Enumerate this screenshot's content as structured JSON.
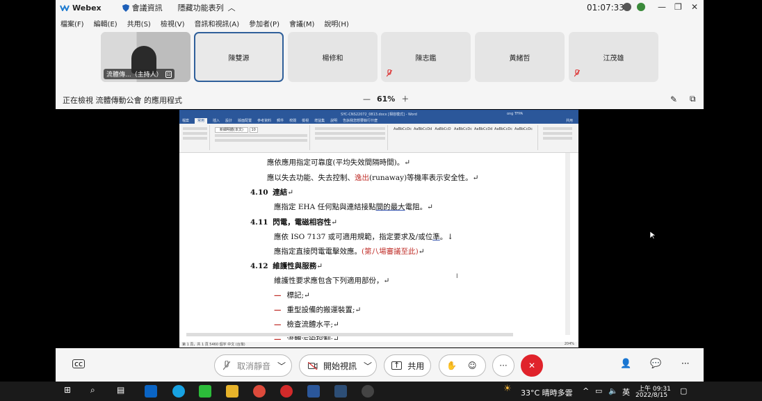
{
  "titlebar": {
    "app": "Webex",
    "meeting_info": "會議資訊",
    "hidden_list": "隱藏功能表列",
    "time": "01:07:33"
  },
  "menu": [
    "檔案(F)",
    "編輯(E)",
    "共用(S)",
    "檢視(V)",
    "音訊和視訊(A)",
    "參加者(P)",
    "會議(M)",
    "說明(H)"
  ],
  "participants": {
    "host": "流體傳...（主持人）",
    "names": [
      "陳雙源",
      "楊修和",
      "陳志鑑",
      "黃緒哲",
      "江茂雄"
    ]
  },
  "viewbar": {
    "viewing": "正在檢視 流體傳動公會 的應用程式",
    "zoom": "61%"
  },
  "word": {
    "title": "SYC-CNS22072_0813.docx [相容模式] - Word",
    "user": "ong TFPA",
    "tabs": [
      "檔案",
      "常用",
      "插入",
      "設計",
      "版面配置",
      "參考資料",
      "郵件",
      "校閱",
      "檢視",
      "增益集",
      "說明",
      "告訴我您想要執行什麼"
    ],
    "share": "共用",
    "font": "新細明體(本文)",
    "size": "10",
    "styles": [
      "AaBbCcDc",
      "AaBbCcDd",
      "AaBbCcD",
      "AaBbCcDc",
      "AaBbCcDd",
      "AaBbCcDc",
      "AaBbCcDc"
    ],
    "status": "第 1 頁，共 1 頁     5460 個字     中文 (台灣)",
    "zoom": "204%"
  },
  "doc": {
    "l1": "應依應用指定可靠度(平均失效間隔時間)。↵",
    "l2a": "應以失去功能、失去控制、",
    "l2b": "逸出",
    "l2c": "(runaway)等機率表示安全性。↵",
    "s410n": "4.10",
    "s410t": "連結",
    "s410e": "↵",
    "l410a": "應指定 EHA 任何點與連結接點",
    "l410b": "間的最大",
    "l410c": "電阻。↵",
    "s411n": "4.11",
    "s411t": "閃電，電磁相容性",
    "s411e": "↵",
    "l411a": "應依 ISO 7137 或可適用規範，指定要求及/或位",
    "l411b": "準",
    "l411c": "。↓",
    "l411d": "應指定直接閃電電擊效應。",
    "l411e": "(第八場審議至此)",
    "l411f": "↵",
    "s412n": "4.12",
    "s412t": "維護性與服務",
    "s412e": "↵",
    "l412": "維護性要求應包含下列適用部份，↵",
    "items": [
      "標記;↵",
      "重型設備的搬運裝置;↵",
      "檢查流體水平;↵",
      "流體污染控制;↵"
    ]
  },
  "bottom": {
    "mute": "取消靜音",
    "video": "開始視訊",
    "share": "共用"
  },
  "taskbar": {
    "weather": "33°C  晴時多雲",
    "ime": "英",
    "time": "上午 09:31",
    "date": "2022/8/15"
  },
  "colors": {
    "accent": "#2f5f9a",
    "end": "#e0232b",
    "word": "#2b579a"
  }
}
